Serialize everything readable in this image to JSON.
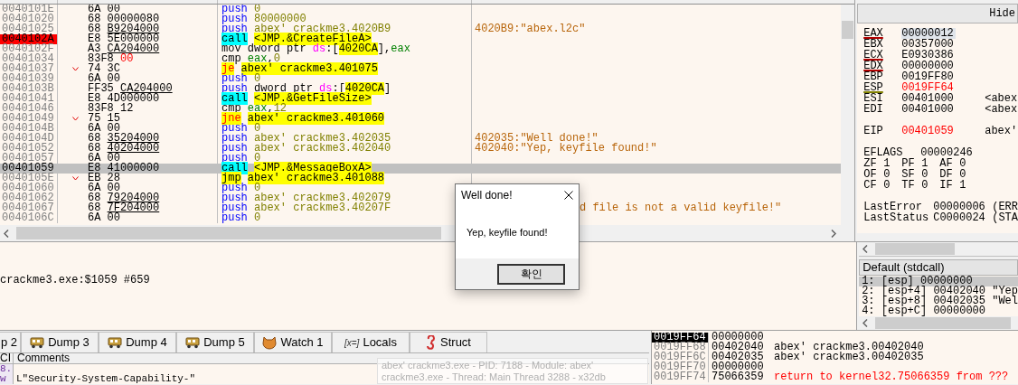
{
  "disassembly": {
    "rows": [
      {
        "address": "0040101E",
        "opcode": "6A",
        "operand": "00",
        "operand_underlined": false,
        "operand_changed": false,
        "jump": false,
        "breakpoint": false,
        "selected": false,
        "tokens": [
          {
            "kind": "push",
            "text": "push"
          },
          {
            "kind": "num",
            "text": "0"
          }
        ]
      },
      {
        "address": "00401020",
        "opcode": "68",
        "operand": "00000080",
        "operand_underlined": false,
        "operand_changed": false,
        "jump": false,
        "breakpoint": false,
        "selected": false,
        "tokens": [
          {
            "kind": "push",
            "text": "push"
          },
          {
            "kind": "num",
            "text": "80000000"
          }
        ]
      },
      {
        "address": "00401025",
        "opcode": "68",
        "operand": "B9204000",
        "operand_underlined": true,
        "operand_changed": false,
        "jump": false,
        "breakpoint": false,
        "selected": false,
        "tokens": [
          {
            "kind": "push",
            "text": "push"
          },
          {
            "kind": "num",
            "text": "abex' crackme3.4020B9"
          }
        ],
        "comment": {
          "text": "4020B9:\"abex.l2c\"",
          "kind": "whole"
        }
      },
      {
        "address": "0040102A",
        "opcode": "E8",
        "operand": "5E000000",
        "operand_underlined": false,
        "operand_changed": false,
        "jump": false,
        "breakpoint": true,
        "selected": false,
        "tokens": [
          {
            "kind": "call",
            "text": "call"
          },
          {
            "kind": "target",
            "text": "<JMP.&CreateFileA>"
          }
        ]
      },
      {
        "address": "0040102F",
        "opcode": "A3",
        "operand": "CA204000",
        "operand_underlined": true,
        "operand_changed": false,
        "jump": false,
        "breakpoint": false,
        "selected": false,
        "tokens": [
          {
            "kind": "plain",
            "text": "mov"
          },
          {
            "kind": "text",
            "text": "dword ptr "
          },
          {
            "kind": "seg",
            "text": "ds"
          },
          {
            "kind": "text",
            "text": ":["
          },
          {
            "kind": "target",
            "text": "4020CA"
          },
          {
            "kind": "text",
            "text": "],"
          },
          {
            "kind": "reg",
            "text": "eax"
          }
        ]
      },
      {
        "address": "00401034",
        "opcode": "83F8",
        "operand": "00",
        "operand_underlined": false,
        "operand_changed": true,
        "jump": false,
        "breakpoint": false,
        "selected": false,
        "tokens": [
          {
            "kind": "plain",
            "text": "cmp"
          },
          {
            "kind": "reg",
            "text": "eax"
          },
          {
            "kind": "text",
            "text": ","
          },
          {
            "kind": "num",
            "text": "0"
          }
        ]
      },
      {
        "address": "00401037",
        "opcode": "74",
        "operand": "3C",
        "operand_underlined": false,
        "operand_changed": false,
        "jump": true,
        "breakpoint": false,
        "selected": false,
        "tokens": [
          {
            "kind": "cjump",
            "text": "je"
          },
          {
            "kind": "target",
            "text": "abex' crackme3.401075"
          }
        ]
      },
      {
        "address": "00401039",
        "opcode": "6A",
        "operand": "00",
        "operand_underlined": false,
        "operand_changed": false,
        "jump": false,
        "breakpoint": false,
        "selected": false,
        "tokens": [
          {
            "kind": "push",
            "text": "push"
          },
          {
            "kind": "num",
            "text": "0"
          }
        ]
      },
      {
        "address": "0040103B",
        "opcode": "FF35",
        "operand": "CA204000",
        "operand_underlined": true,
        "operand_changed": false,
        "jump": false,
        "breakpoint": false,
        "selected": false,
        "tokens": [
          {
            "kind": "push",
            "text": "push"
          },
          {
            "kind": "text",
            "text": "dword ptr "
          },
          {
            "kind": "seg",
            "text": "ds"
          },
          {
            "kind": "text",
            "text": ":["
          },
          {
            "kind": "target",
            "text": "4020CA"
          },
          {
            "kind": "text",
            "text": "]"
          }
        ]
      },
      {
        "address": "00401041",
        "opcode": "E8",
        "operand": "4D000000",
        "operand_underlined": false,
        "operand_changed": false,
        "jump": false,
        "breakpoint": false,
        "selected": false,
        "tokens": [
          {
            "kind": "call",
            "text": "call"
          },
          {
            "kind": "target",
            "text": "<JMP.&GetFileSize>"
          }
        ]
      },
      {
        "address": "00401046",
        "opcode": "83F8",
        "operand": "12",
        "operand_underlined": false,
        "operand_changed": false,
        "jump": false,
        "breakpoint": false,
        "selected": false,
        "tokens": [
          {
            "kind": "plain",
            "text": "cmp"
          },
          {
            "kind": "reg",
            "text": "eax"
          },
          {
            "kind": "text",
            "text": ","
          },
          {
            "kind": "num",
            "text": "12"
          }
        ]
      },
      {
        "address": "00401049",
        "opcode": "75",
        "operand": "15",
        "operand_underlined": false,
        "operand_changed": false,
        "jump": true,
        "breakpoint": false,
        "selected": false,
        "tokens": [
          {
            "kind": "cjump",
            "text": "jne"
          },
          {
            "kind": "target",
            "text": "abex' crackme3.401060"
          }
        ]
      },
      {
        "address": "0040104B",
        "opcode": "6A",
        "operand": "00",
        "operand_underlined": false,
        "operand_changed": false,
        "jump": false,
        "breakpoint": false,
        "selected": false,
        "tokens": [
          {
            "kind": "push",
            "text": "push"
          },
          {
            "kind": "num",
            "text": "0"
          }
        ]
      },
      {
        "address": "0040104D",
        "opcode": "68",
        "operand": "35204000",
        "operand_underlined": true,
        "operand_changed": false,
        "jump": false,
        "breakpoint": false,
        "selected": false,
        "tokens": [
          {
            "kind": "push",
            "text": "push"
          },
          {
            "kind": "num",
            "text": "abex' crackme3.402035"
          }
        ],
        "comment": {
          "text": "402035:\"Well done!\"",
          "kind": "whole"
        }
      },
      {
        "address": "00401052",
        "opcode": "68",
        "operand": "40204000",
        "operand_underlined": true,
        "operand_changed": false,
        "jump": false,
        "breakpoint": false,
        "selected": false,
        "tokens": [
          {
            "kind": "push",
            "text": "push"
          },
          {
            "kind": "num",
            "text": "abex' crackme3.402040"
          }
        ],
        "comment": {
          "text": "402040:\"Yep, keyfile found!\"",
          "kind": "whole"
        }
      },
      {
        "address": "00401057",
        "opcode": "6A",
        "operand": "00",
        "operand_underlined": false,
        "operand_changed": false,
        "jump": false,
        "breakpoint": false,
        "selected": false,
        "tokens": [
          {
            "kind": "push",
            "text": "push"
          },
          {
            "kind": "num",
            "text": "0"
          }
        ]
      },
      {
        "address": "00401059",
        "opcode": "E8",
        "operand": "41000000",
        "operand_underlined": false,
        "operand_changed": false,
        "jump": false,
        "breakpoint": false,
        "selected": true,
        "tokens": [
          {
            "kind": "call",
            "text": "call"
          },
          {
            "kind": "target",
            "text": "<JMP.&MessageBoxA>"
          }
        ]
      },
      {
        "address": "0040105E",
        "opcode": "EB",
        "operand": "28",
        "operand_underlined": false,
        "operand_changed": false,
        "jump": true,
        "breakpoint": false,
        "selected": false,
        "tokens": [
          {
            "kind": "jump",
            "text": "jmp"
          },
          {
            "kind": "target",
            "text": "abex' crackme3.401088"
          }
        ]
      },
      {
        "address": "00401060",
        "opcode": "6A",
        "operand": "00",
        "operand_underlined": false,
        "operand_changed": false,
        "jump": false,
        "breakpoint": false,
        "selected": false,
        "tokens": [
          {
            "kind": "push",
            "text": "push"
          },
          {
            "kind": "num",
            "text": "0"
          }
        ]
      },
      {
        "address": "00401062",
        "opcode": "68",
        "operand": "79204000",
        "operand_underlined": true,
        "operand_changed": false,
        "jump": false,
        "breakpoint": false,
        "selected": false,
        "tokens": [
          {
            "kind": "push",
            "text": "push"
          },
          {
            "kind": "num",
            "text": "abex' crackme3.402079"
          }
        ]
      },
      {
        "address": "00401067",
        "opcode": "68",
        "operand": "7F204000",
        "operand_underlined": true,
        "operand_changed": false,
        "jump": false,
        "breakpoint": false,
        "selected": false,
        "tokens": [
          {
            "kind": "push",
            "text": "push"
          },
          {
            "kind": "num",
            "text": "abex' crackme3.40207F"
          }
        ],
        "comment": {
          "text": "d file is not a valid keyfile!\"",
          "kind": "clipped"
        }
      },
      {
        "address": "0040106C",
        "opcode": "6A",
        "operand": "00",
        "operand_underlined": false,
        "operand_changed": false,
        "jump": false,
        "breakpoint": false,
        "selected": false,
        "tokens": [
          {
            "kind": "push",
            "text": "push"
          },
          {
            "kind": "num",
            "text": "0"
          }
        ]
      }
    ]
  },
  "registers": {
    "hide_button": "Hide",
    "groups": [
      [
        {
          "name": "EAX",
          "value": "00000012",
          "color": "#b00000",
          "changed": false,
          "selected": true
        },
        {
          "name": "EBX",
          "value": "00357000",
          "changed": false,
          "selected": false
        },
        {
          "name": "ECX",
          "value": "E0930386",
          "color": "#b00000",
          "changed": false,
          "selected": false
        },
        {
          "name": "EDX",
          "value": "00000000",
          "color": "#b00000",
          "changed": false,
          "selected": false
        },
        {
          "name": "EBP",
          "value": "0019FF80",
          "changed": false,
          "selected": false
        },
        {
          "name": "ESP",
          "value": "0019FF64",
          "color": "#808000",
          "changed": true,
          "selected": false
        },
        {
          "name": "ESI",
          "value": "00401000",
          "note": "<abex",
          "changed": false,
          "selected": false
        },
        {
          "name": "EDI",
          "value": "00401000",
          "note": "<abex",
          "changed": false,
          "selected": false
        }
      ],
      [
        {
          "name": "EIP",
          "value": "00401059",
          "note": "abex'",
          "changed": true,
          "selected": false
        }
      ]
    ],
    "eflags": {
      "name": "EFLAGS",
      "value": "00000246"
    },
    "flags": [
      [
        {
          "name": "ZF",
          "value": "1"
        },
        {
          "name": "PF",
          "value": "1"
        },
        {
          "name": "AF",
          "value": "0"
        }
      ],
      [
        {
          "name": "OF",
          "value": "0"
        },
        {
          "name": "SF",
          "value": "0"
        },
        {
          "name": "DF",
          "value": "0"
        }
      ],
      [
        {
          "name": "CF",
          "value": "0"
        },
        {
          "name": "TF",
          "value": "0"
        },
        {
          "name": "IF",
          "value": "1"
        }
      ]
    ],
    "status": [
      {
        "name": "LastError",
        "value": "00000006",
        "note": "(ERR"
      },
      {
        "name": "LastStatus",
        "value": "C0000024",
        "note": "(STA"
      }
    ]
  },
  "log": {
    "lines": [
      "crackme3.exe:$1059 #659"
    ]
  },
  "call_stack": {
    "convention": "Default (stdcall)",
    "items": [
      {
        "text": "1: [esp] 00000000",
        "selected": true
      },
      {
        "text": "2: [esp+4] 00402040 \"Yep",
        "selected": false
      },
      {
        "text": "3: [esp+8] 00402035 \"Wel",
        "selected": false
      },
      {
        "text": "4: [esp+C] 00000000",
        "selected": false
      }
    ]
  },
  "dialog": {
    "title": "Well done!",
    "message": "Yep, keyfile found!",
    "button": "확인"
  },
  "bottom_tabs": [
    {
      "label": "p 2",
      "kind": "partial",
      "selected": false
    },
    {
      "label": "Dump 3",
      "kind": "dump",
      "selected": false
    },
    {
      "label": "Dump 4",
      "kind": "dump",
      "selected": false
    },
    {
      "label": "Dump 5",
      "kind": "dump",
      "selected": false
    },
    {
      "label": "Watch 1",
      "kind": "watch",
      "selected": false
    },
    {
      "label": "Locals",
      "kind": "locals",
      "icon_text": "[x=]",
      "selected": false
    },
    {
      "label": "Struct",
      "kind": "struct",
      "selected": false
    }
  ],
  "dump": {
    "columns": [
      "CI",
      "Comments"
    ],
    "rows": [
      {
        "gutter": "8."
      },
      {
        "gutter": "w",
        "comment": "L\"Security-System-Capability-\""
      }
    ]
  },
  "tooltip": {
    "lines": [
      "abex' crackme3.exe - PID: 7188 - Module: abex'",
      "crackme3.exe - Thread: Main Thread 3288 - x32db"
    ]
  },
  "stack": {
    "rows": [
      {
        "address": "0019FF64",
        "value": "00000000",
        "selected": true
      },
      {
        "address": "0019FF68",
        "value": "00402040",
        "comment": "abex' crackme3.00402040",
        "kind": "plain",
        "selected": false
      },
      {
        "address": "0019FF6C",
        "value": "00402035",
        "comment": "abex' crackme3.00402035",
        "kind": "plain",
        "selected": false
      },
      {
        "address": "0019FF70",
        "value": "00000000",
        "selected": false
      },
      {
        "address": "0019FF74",
        "value": "75066359",
        "comment": "return to kernel32.75066359 from ???",
        "kind": "return",
        "selected": false
      }
    ]
  }
}
